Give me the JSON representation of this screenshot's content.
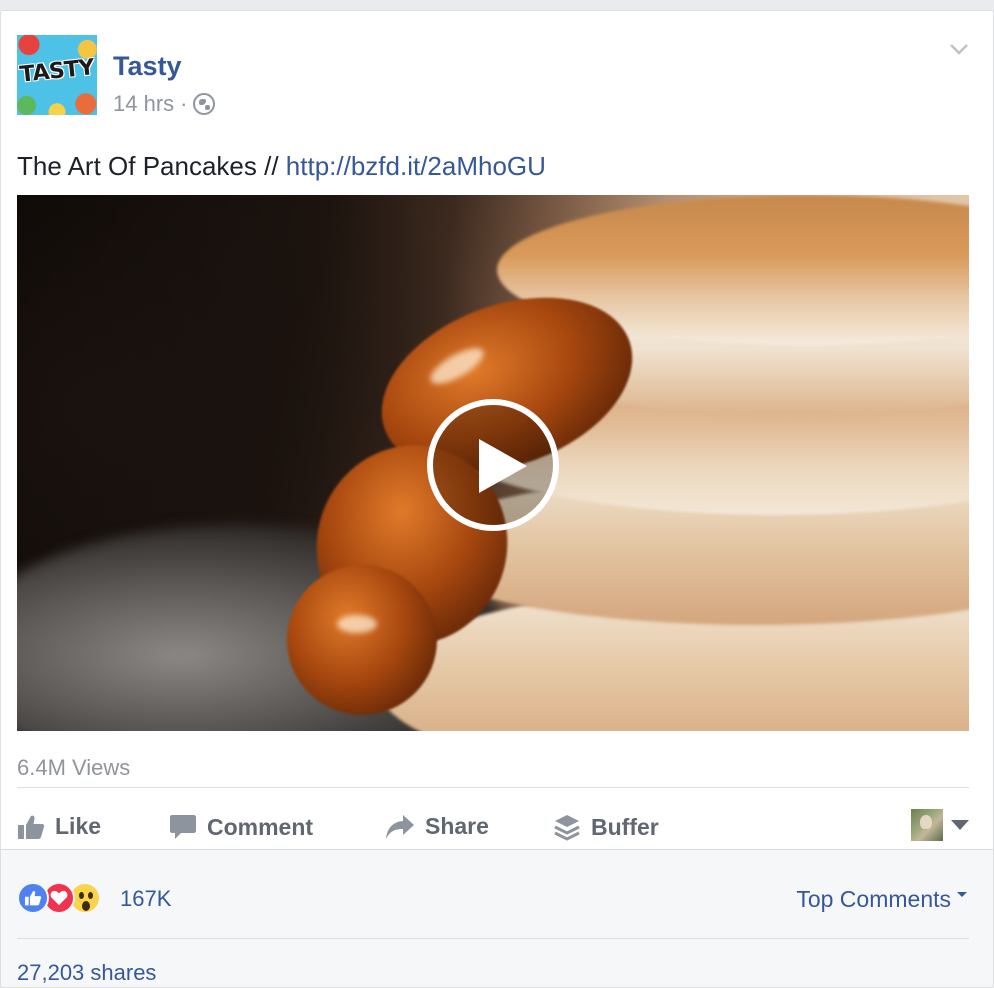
{
  "post": {
    "page_name": "Tasty",
    "avatar_logo_text": "TASTY",
    "time": "14 hrs",
    "separator": "·",
    "privacy_icon": "globe-icon",
    "text": "The Art Of Pancakes //",
    "link": "http://bzfd.it/2aMhoGU"
  },
  "video": {
    "views": "6.4M Views",
    "play_icon": "play-icon"
  },
  "actions": {
    "like_label": "Like",
    "comment_label": "Comment",
    "share_label": "Share",
    "buffer_label": "Buffer"
  },
  "reactions": {
    "icons": [
      "like-reaction-icon",
      "love-reaction-icon",
      "wow-reaction-icon"
    ],
    "count": "167K",
    "sort_label": "Top Comments",
    "shares": "27,203 shares"
  },
  "colors": {
    "link_blue": "#365899",
    "meta_gray": "#90949c",
    "action_gray": "#606770",
    "like_blue": "#4f82f0",
    "love_red": "#f0334e",
    "wow_yellow": "#fcd34d"
  }
}
